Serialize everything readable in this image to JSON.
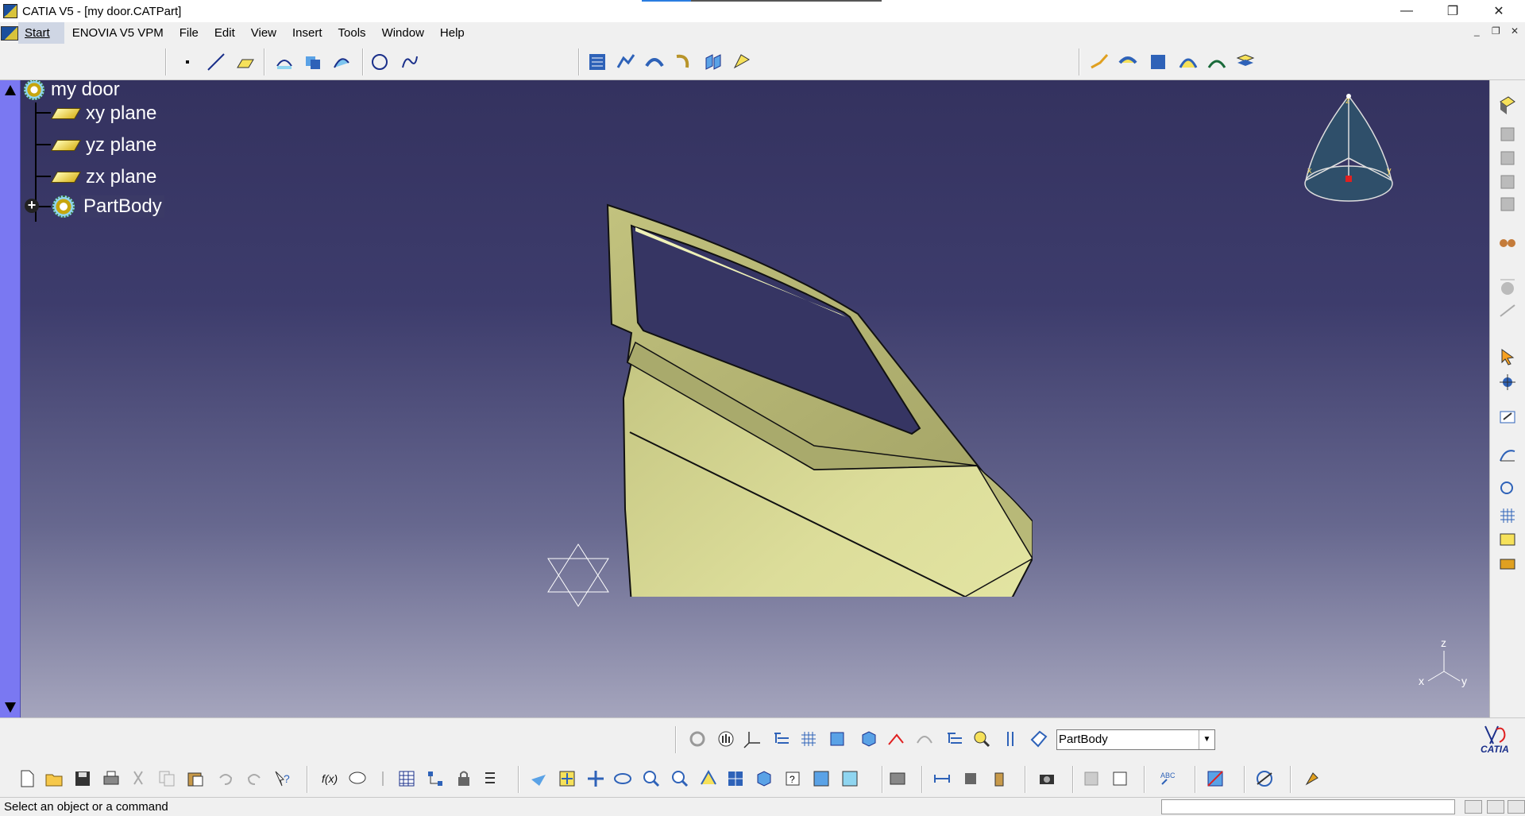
{
  "window": {
    "title": "CATIA V5 - [my door.CATPart]",
    "minimize_glyph": "—",
    "maximize_glyph": "❐",
    "close_glyph": "✕"
  },
  "menubar": {
    "items": [
      "Start",
      "ENOVIA V5 VPM",
      "File",
      "Edit",
      "View",
      "Insert",
      "Tools",
      "Window",
      "Help"
    ],
    "mdi_minimize": "_",
    "mdi_restore": "❐",
    "mdi_close": "✕"
  },
  "tree": {
    "root": "my door",
    "children": [
      "xy plane",
      "yz plane",
      "zx plane",
      "PartBody"
    ],
    "expand_glyph": "+"
  },
  "compass": {
    "axis_z": "z",
    "axis_x": "x",
    "axis_y": "y"
  },
  "triad": {
    "axis_z": "z",
    "axis_x": "x",
    "axis_y": "y"
  },
  "current_body": "PartBody",
  "logo_text": "CATIA",
  "status": {
    "message": "Select an object or a command"
  },
  "icons": {
    "top_toolbar": [
      "point-icon",
      "line-icon",
      "plane-icon",
      "projection-icon",
      "intersection-icon",
      "parallel-curve-icon",
      "circle-icon",
      "spline-icon",
      "sketch-tracer-icon",
      "curve-creation-icon",
      "surface-icon",
      "sweep-icon",
      "fill-icon",
      "operations-icon",
      "join-icon",
      "extrapolate-icon",
      "fillet-icon",
      "translate-icon",
      "extract-icon"
    ],
    "right_toolbar": [
      "render-style-icon",
      "view-icon",
      "view-icon",
      "view-icon",
      "view-icon",
      "catalog-icon",
      "knowledge-icon",
      "formula-icon",
      "law-icon",
      "select-arrow-icon",
      "snap-icon",
      "sketch-icon",
      "analysis-icon",
      "repeat-icon",
      "grid-icon",
      "insert-icon",
      "exit-icon"
    ],
    "bottom_toolbar": [
      "new-icon",
      "open-icon",
      "save-icon",
      "print-icon",
      "cut-icon",
      "copy-icon",
      "paste-icon",
      "undo-icon",
      "redo-icon",
      "whats-this-icon",
      "formula-icon",
      "comment-icon",
      "measure-icon",
      "table-icon",
      "hierarchy-icon",
      "lock-icon",
      "list-icon",
      "fly-icon",
      "fit-all-icon",
      "pan-icon",
      "rotate-icon",
      "zoom-in-icon",
      "zoom-out-icon",
      "normal-view-icon",
      "multi-view-icon",
      "iso-view-icon",
      "hide-show-icon",
      "swap-icon",
      "swap-visible-icon",
      "update-icon",
      "measure-between-icon",
      "measure-item-icon",
      "inertia-icon",
      "camera-icon",
      "catalog-icon",
      "sketch-analysis-icon",
      "spell-check-icon",
      "analysis-icon",
      "connect-icon",
      "tool-icon"
    ],
    "upper_bottom_toolbar": [
      "repeat-icon",
      "hand-icon",
      "axis-icon",
      "tree-icon",
      "grid-icon",
      "solid-icon",
      "shape-icon",
      "point-cloud-icon",
      "surface-shape-icon",
      "tree-expand-icon",
      "lookup-icon",
      "ruler-icon",
      "current-body-icon"
    ]
  }
}
